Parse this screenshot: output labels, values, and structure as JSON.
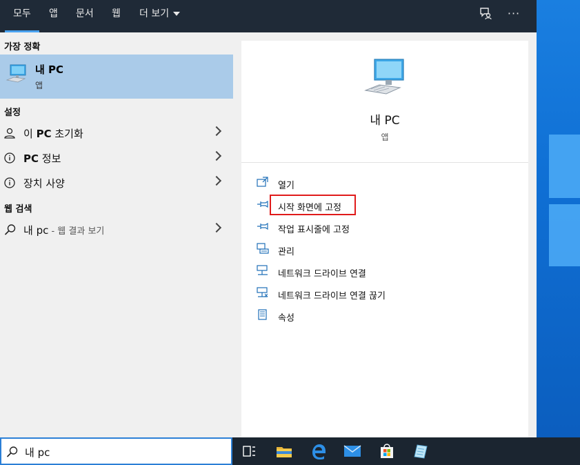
{
  "tabs": [
    {
      "label": "모두",
      "active": true
    },
    {
      "label": "앱"
    },
    {
      "label": "문서"
    },
    {
      "label": "웹"
    },
    {
      "label": "더 보기"
    }
  ],
  "topbar_icons": [
    "feedback-icon",
    "more-options-icon"
  ],
  "more_label": "···",
  "sections": {
    "best_match": "가장 정확",
    "settings": "설정",
    "web": "웹 검색"
  },
  "best_match": {
    "title": "내 PC",
    "subtitle": "앱"
  },
  "settings_items": [
    {
      "pre": "이 ",
      "bold": "PC",
      "post": " 초기화",
      "icon": "reset-icon"
    },
    {
      "pre": "",
      "bold": "PC",
      "post": " 정보",
      "icon": "info-icon"
    },
    {
      "pre": "",
      "bold": "",
      "post": "장치 사양",
      "icon": "info-icon"
    }
  ],
  "web_item": {
    "query": "내 pc",
    "suffix": " - 웹 결과 보기"
  },
  "preview": {
    "title": "내 PC",
    "subtitle": "앱"
  },
  "actions": [
    {
      "label": "열기",
      "icon": "open-icon"
    },
    {
      "label": "시작 화면에 고정",
      "icon": "pin-icon"
    },
    {
      "label": "작업 표시줄에 고정",
      "icon": "pin-icon"
    },
    {
      "label": "관리",
      "icon": "manage-icon"
    },
    {
      "label": "네트워크 드라이브 연결",
      "icon": "network-drive-icon"
    },
    {
      "label": "네트워크 드라이브 연결 끊기",
      "icon": "network-drive-icon"
    },
    {
      "label": "속성",
      "icon": "properties-icon"
    }
  ],
  "search": {
    "value": "내 pc"
  },
  "taskbar_icons": [
    "task-view-icon",
    "file-explorer-icon",
    "edge-icon",
    "mail-icon",
    "store-icon",
    "notepad-icon"
  ],
  "colors": {
    "accent": "#4aa3f0",
    "highlight": "#e01a1a",
    "selection": "#aacbe9",
    "topbar": "#1f2a37"
  }
}
